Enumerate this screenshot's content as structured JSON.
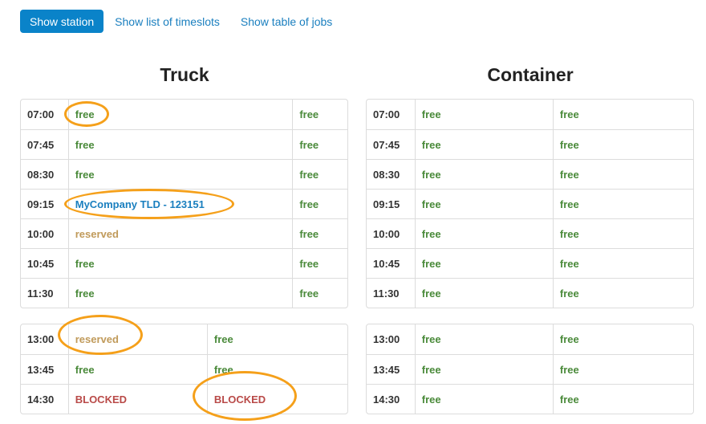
{
  "nav": {
    "show_station": "Show station",
    "show_timeslots": "Show list of timeslots",
    "show_jobs": "Show table of jobs"
  },
  "stations": [
    {
      "name": "Truck",
      "blocks": [
        {
          "rows": [
            {
              "time": "07:00",
              "cells": [
                {
                  "text": "free",
                  "status": "free"
                },
                {
                  "text": "free",
                  "status": "free"
                }
              ]
            },
            {
              "time": "07:45",
              "cells": [
                {
                  "text": "free",
                  "status": "free"
                },
                {
                  "text": "free",
                  "status": "free"
                }
              ]
            },
            {
              "time": "08:30",
              "cells": [
                {
                  "text": "free",
                  "status": "free"
                },
                {
                  "text": "free",
                  "status": "free"
                }
              ]
            },
            {
              "time": "09:15",
              "cells": [
                {
                  "text": "MyCompany TLD - 123151",
                  "status": "booked"
                },
                {
                  "text": "free",
                  "status": "free"
                }
              ]
            },
            {
              "time": "10:00",
              "cells": [
                {
                  "text": "reserved",
                  "status": "reserved"
                },
                {
                  "text": "free",
                  "status": "free"
                }
              ]
            },
            {
              "time": "10:45",
              "cells": [
                {
                  "text": "free",
                  "status": "free"
                },
                {
                  "text": "free",
                  "status": "free"
                }
              ]
            },
            {
              "time": "11:30",
              "cells": [
                {
                  "text": "free",
                  "status": "free"
                },
                {
                  "text": "free",
                  "status": "free"
                }
              ]
            }
          ]
        },
        {
          "rows": [
            {
              "time": "13:00",
              "cells": [
                {
                  "text": "reserved",
                  "status": "reserved"
                },
                {
                  "text": "free",
                  "status": "free"
                }
              ]
            },
            {
              "time": "13:45",
              "cells": [
                {
                  "text": "free",
                  "status": "free"
                },
                {
                  "text": "free",
                  "status": "free"
                }
              ]
            },
            {
              "time": "14:30",
              "cells": [
                {
                  "text": "BLOCKED",
                  "status": "blocked"
                },
                {
                  "text": "BLOCKED",
                  "status": "blocked"
                }
              ]
            }
          ]
        }
      ]
    },
    {
      "name": "Container",
      "blocks": [
        {
          "rows": [
            {
              "time": "07:00",
              "cells": [
                {
                  "text": "free",
                  "status": "free"
                },
                {
                  "text": "free",
                  "status": "free"
                }
              ]
            },
            {
              "time": "07:45",
              "cells": [
                {
                  "text": "free",
                  "status": "free"
                },
                {
                  "text": "free",
                  "status": "free"
                }
              ]
            },
            {
              "time": "08:30",
              "cells": [
                {
                  "text": "free",
                  "status": "free"
                },
                {
                  "text": "free",
                  "status": "free"
                }
              ]
            },
            {
              "time": "09:15",
              "cells": [
                {
                  "text": "free",
                  "status": "free"
                },
                {
                  "text": "free",
                  "status": "free"
                }
              ]
            },
            {
              "time": "10:00",
              "cells": [
                {
                  "text": "free",
                  "status": "free"
                },
                {
                  "text": "free",
                  "status": "free"
                }
              ]
            },
            {
              "time": "10:45",
              "cells": [
                {
                  "text": "free",
                  "status": "free"
                },
                {
                  "text": "free",
                  "status": "free"
                }
              ]
            },
            {
              "time": "11:30",
              "cells": [
                {
                  "text": "free",
                  "status": "free"
                },
                {
                  "text": "free",
                  "status": "free"
                }
              ]
            }
          ]
        },
        {
          "rows": [
            {
              "time": "13:00",
              "cells": [
                {
                  "text": "free",
                  "status": "free"
                },
                {
                  "text": "free",
                  "status": "free"
                }
              ]
            },
            {
              "time": "13:45",
              "cells": [
                {
                  "text": "free",
                  "status": "free"
                },
                {
                  "text": "free",
                  "status": "free"
                }
              ]
            },
            {
              "time": "14:30",
              "cells": [
                {
                  "text": "free",
                  "status": "free"
                },
                {
                  "text": "free",
                  "status": "free"
                }
              ]
            }
          ]
        }
      ]
    }
  ],
  "colors": {
    "primary": "#0a83c9",
    "link": "#1a7fbf",
    "free": "#4a8a3a",
    "reserved": "#c09a5a",
    "blocked": "#b94a48",
    "highlight": "#f5a01a"
  }
}
